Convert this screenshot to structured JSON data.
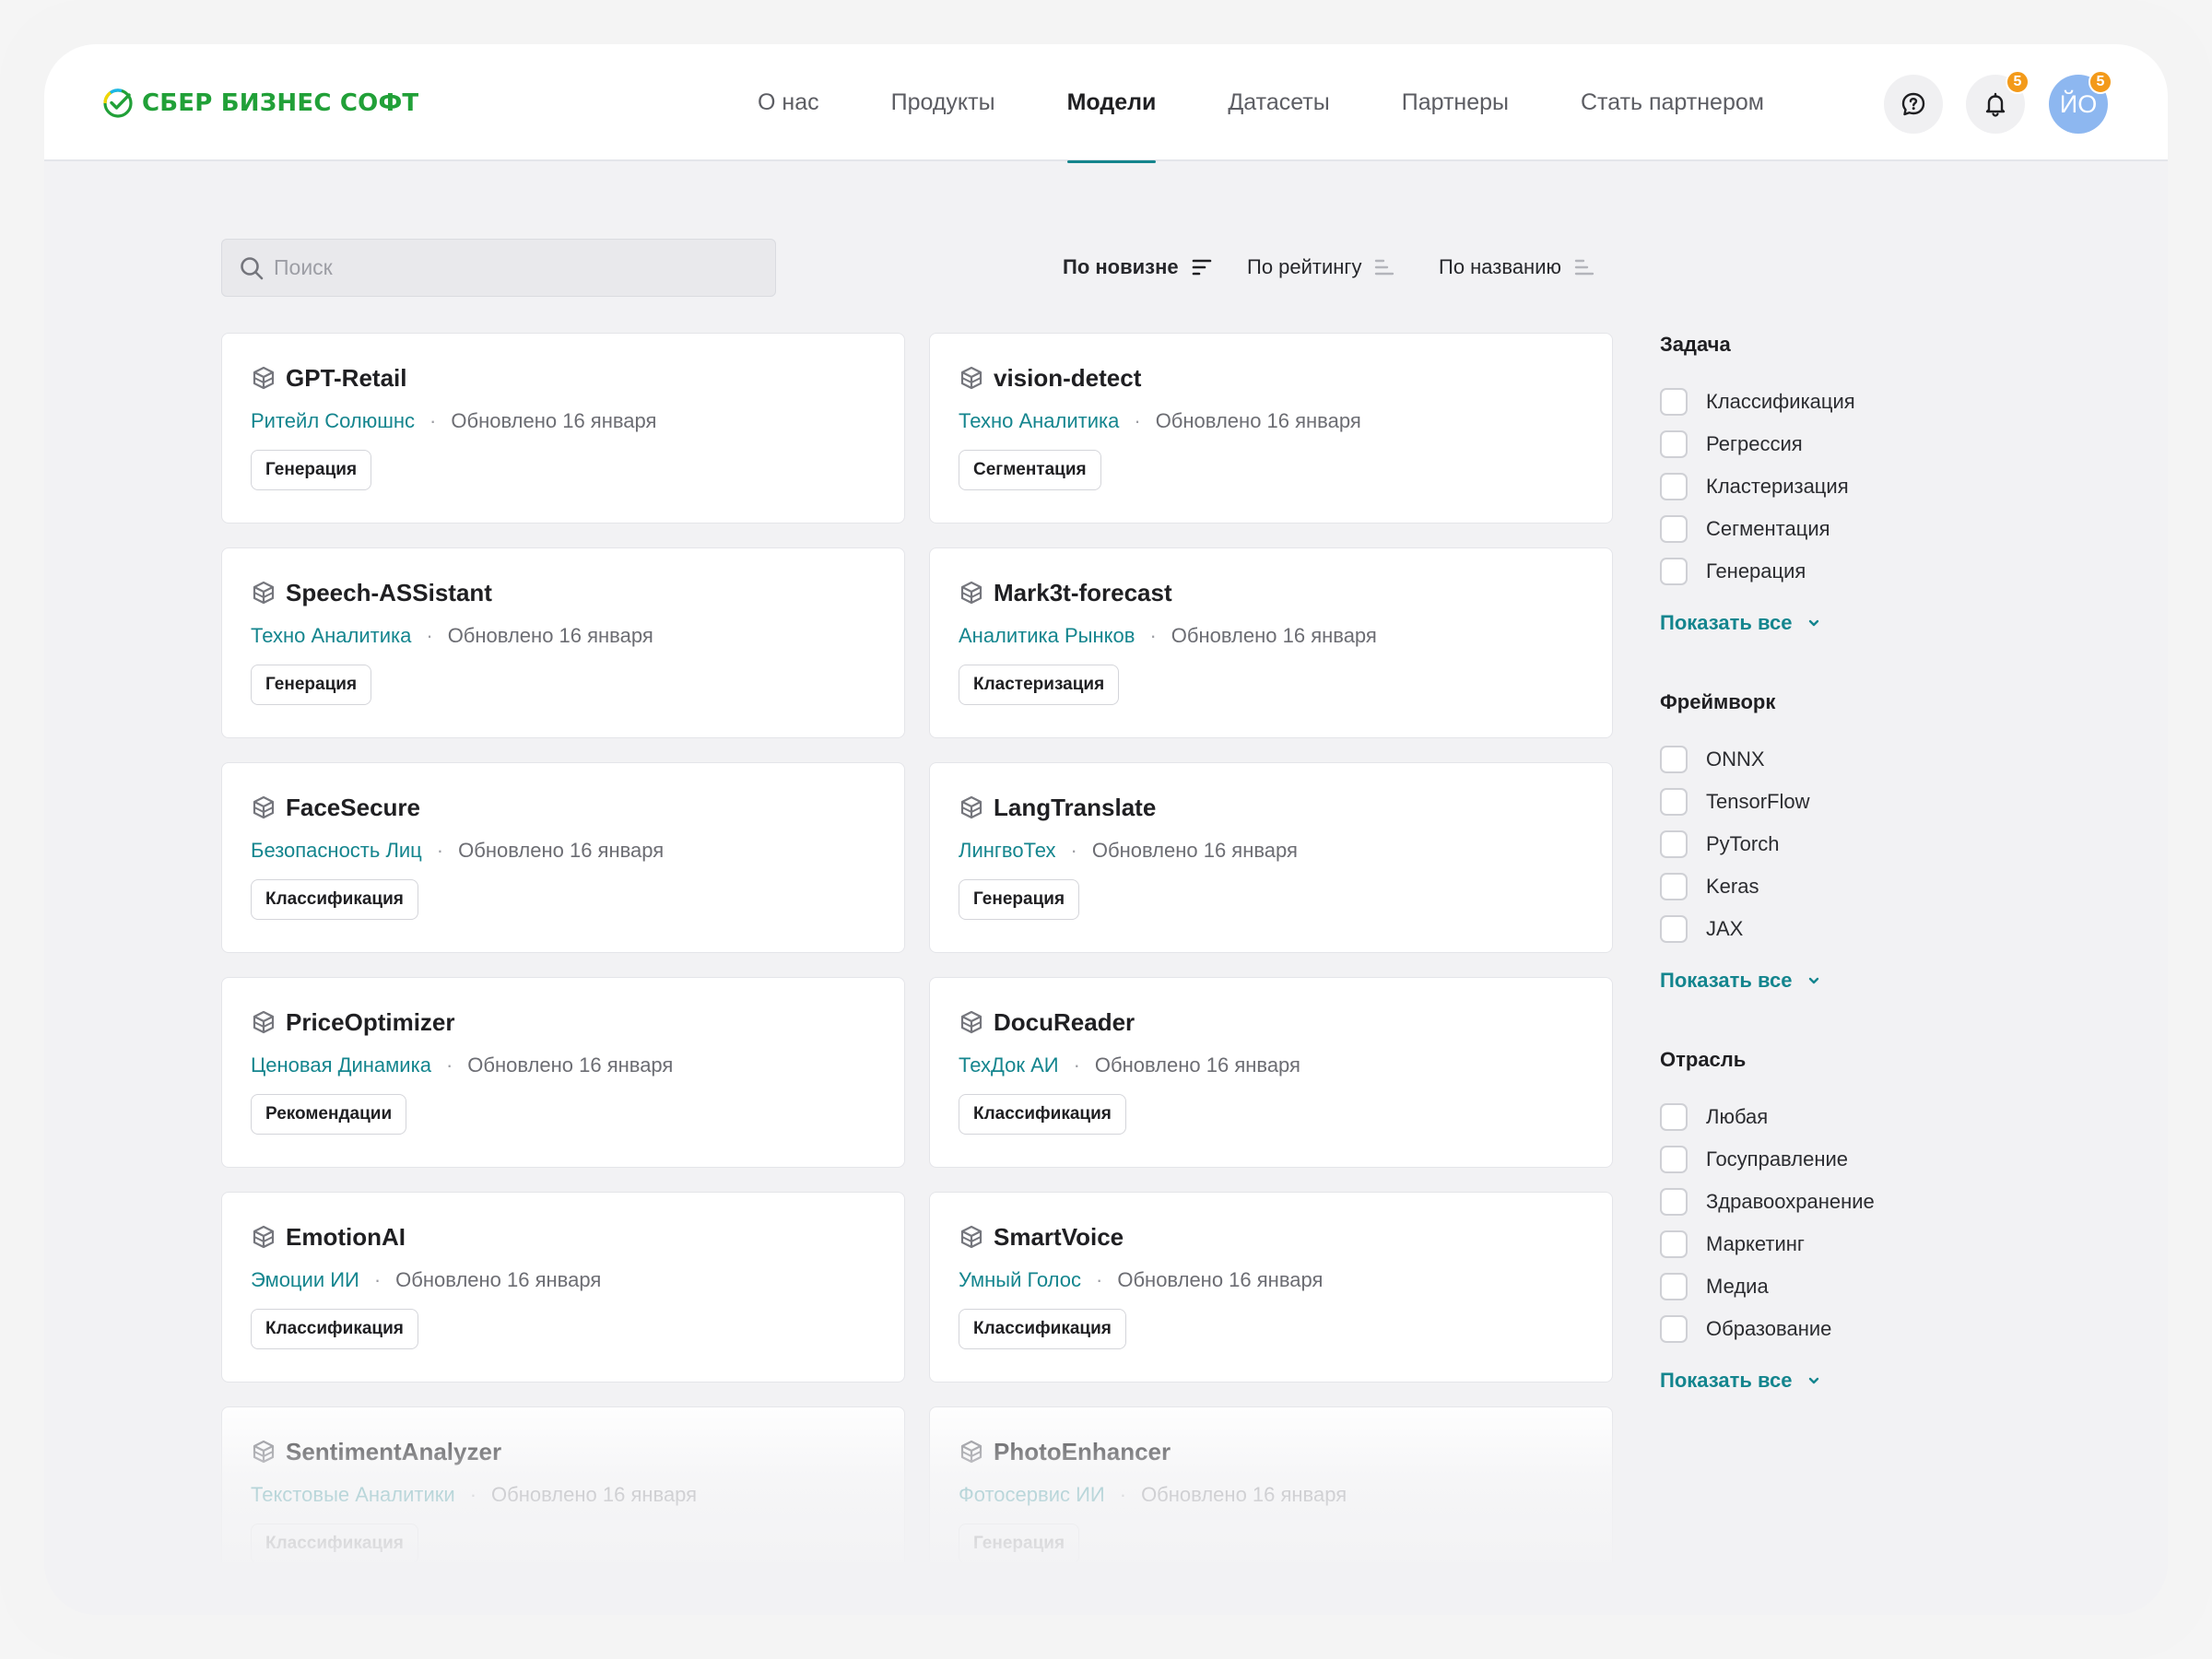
{
  "brand": {
    "name": "СБЕР БИЗНЕС СОФТ",
    "color": "#21a038"
  },
  "nav": {
    "items": [
      {
        "label": "О нас",
        "active": false
      },
      {
        "label": "Продукты",
        "active": false
      },
      {
        "label": "Модели",
        "active": true
      },
      {
        "label": "Датасеты",
        "active": false
      },
      {
        "label": "Партнеры",
        "active": false
      },
      {
        "label": "Стать партнером",
        "active": false
      }
    ]
  },
  "header_actions": {
    "support_icon": "question-chat-icon",
    "notifications_icon": "bell-icon",
    "notifications_badge": "5",
    "avatar_initials": "ЙО",
    "avatar_badge": "5",
    "badge_color": "#f39a1a"
  },
  "search": {
    "placeholder": "Поиск",
    "value": ""
  },
  "sort": {
    "options": [
      {
        "label": "По новизне",
        "active": true
      },
      {
        "label": "По рейтингу",
        "active": false
      },
      {
        "label": "По названию",
        "active": false
      }
    ]
  },
  "accent_color": "#14858e",
  "models": [
    {
      "title": "GPT-Retail",
      "author": "Ритейл Солюшнс",
      "updated": "Обновлено 16 января",
      "tag": "Генерация"
    },
    {
      "title": "vision-detect",
      "author": "Техно Аналитика",
      "updated": "Обновлено 16 января",
      "tag": "Сегментация"
    },
    {
      "title": "Speech-ASSistant",
      "author": "Техно Аналитика",
      "updated": "Обновлено 16 января",
      "tag": "Генерация"
    },
    {
      "title": "Mark3t-forecast",
      "author": "Аналитика Рынков",
      "updated": "Обновлено 16 января",
      "tag": "Кластеризация"
    },
    {
      "title": "FaceSecure",
      "author": "Безопасность Лиц",
      "updated": "Обновлено 16 января",
      "tag": "Классификация"
    },
    {
      "title": "LangTranslate",
      "author": "ЛингвоТех",
      "updated": "Обновлено 16 января",
      "tag": "Генерация"
    },
    {
      "title": "PriceOptimizer",
      "author": "Ценовая Динамика",
      "updated": "Обновлено 16 января",
      "tag": "Рекомендации"
    },
    {
      "title": "DocuReader",
      "author": "ТехДок АИ",
      "updated": "Обновлено 16 января",
      "tag": "Классификация"
    },
    {
      "title": "EmotionAI",
      "author": "Эмоции ИИ",
      "updated": "Обновлено 16 января",
      "tag": "Классификация"
    },
    {
      "title": "SmartVoice",
      "author": "Умный Голос",
      "updated": "Обновлено 16 января",
      "tag": "Классификация"
    },
    {
      "title": "SentimentAnalyzer",
      "author": "Текстовые Аналитики",
      "updated": "Обновлено 16 января",
      "tag": "Классификация"
    },
    {
      "title": "PhotoEnhancer",
      "author": "Фотосервис ИИ",
      "updated": "Обновлено 16 января",
      "tag": "Генерация"
    }
  ],
  "filters": [
    {
      "title": "Задача",
      "options": [
        "Классификация",
        "Регрессия",
        "Кластеризация",
        "Сегментация",
        "Генерация"
      ],
      "show_all": "Показать все"
    },
    {
      "title": "Фреймворк",
      "options": [
        "ONNX",
        "TensorFlow",
        "PyTorch",
        "Keras",
        "JAX"
      ],
      "show_all": "Показать все"
    },
    {
      "title": "Отрасль",
      "options": [
        "Любая",
        "Госуправление",
        "Здравоохранение",
        "Маркетинг",
        "Медиа",
        "Образование"
      ],
      "show_all": "Показать все"
    }
  ]
}
